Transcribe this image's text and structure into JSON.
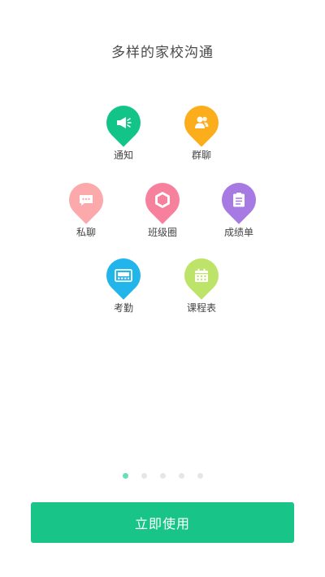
{
  "title": "多样的家校沟通",
  "features": [
    {
      "label": "通知",
      "color": "#13c489",
      "icon": "megaphone-icon"
    },
    {
      "label": "群聊",
      "color": "#fbad1b",
      "icon": "group-icon"
    },
    {
      "label": "私聊",
      "color": "#fca9ab",
      "icon": "chat-bubble-icon"
    },
    {
      "label": "班级圈",
      "color": "#f7809d",
      "icon": "hexagon-icon"
    },
    {
      "label": "成绩单",
      "color": "#a779e2",
      "icon": "report-card-icon"
    },
    {
      "label": "考勤",
      "color": "#21b5eb",
      "icon": "clock-device-icon"
    },
    {
      "label": "课程表",
      "color": "#bde469",
      "icon": "calendar-icon"
    }
  ],
  "pagination": {
    "pages": 5,
    "active": 1,
    "active_color": "#64e0b4"
  },
  "button": {
    "label": "立即使用",
    "color": "#18c488"
  }
}
